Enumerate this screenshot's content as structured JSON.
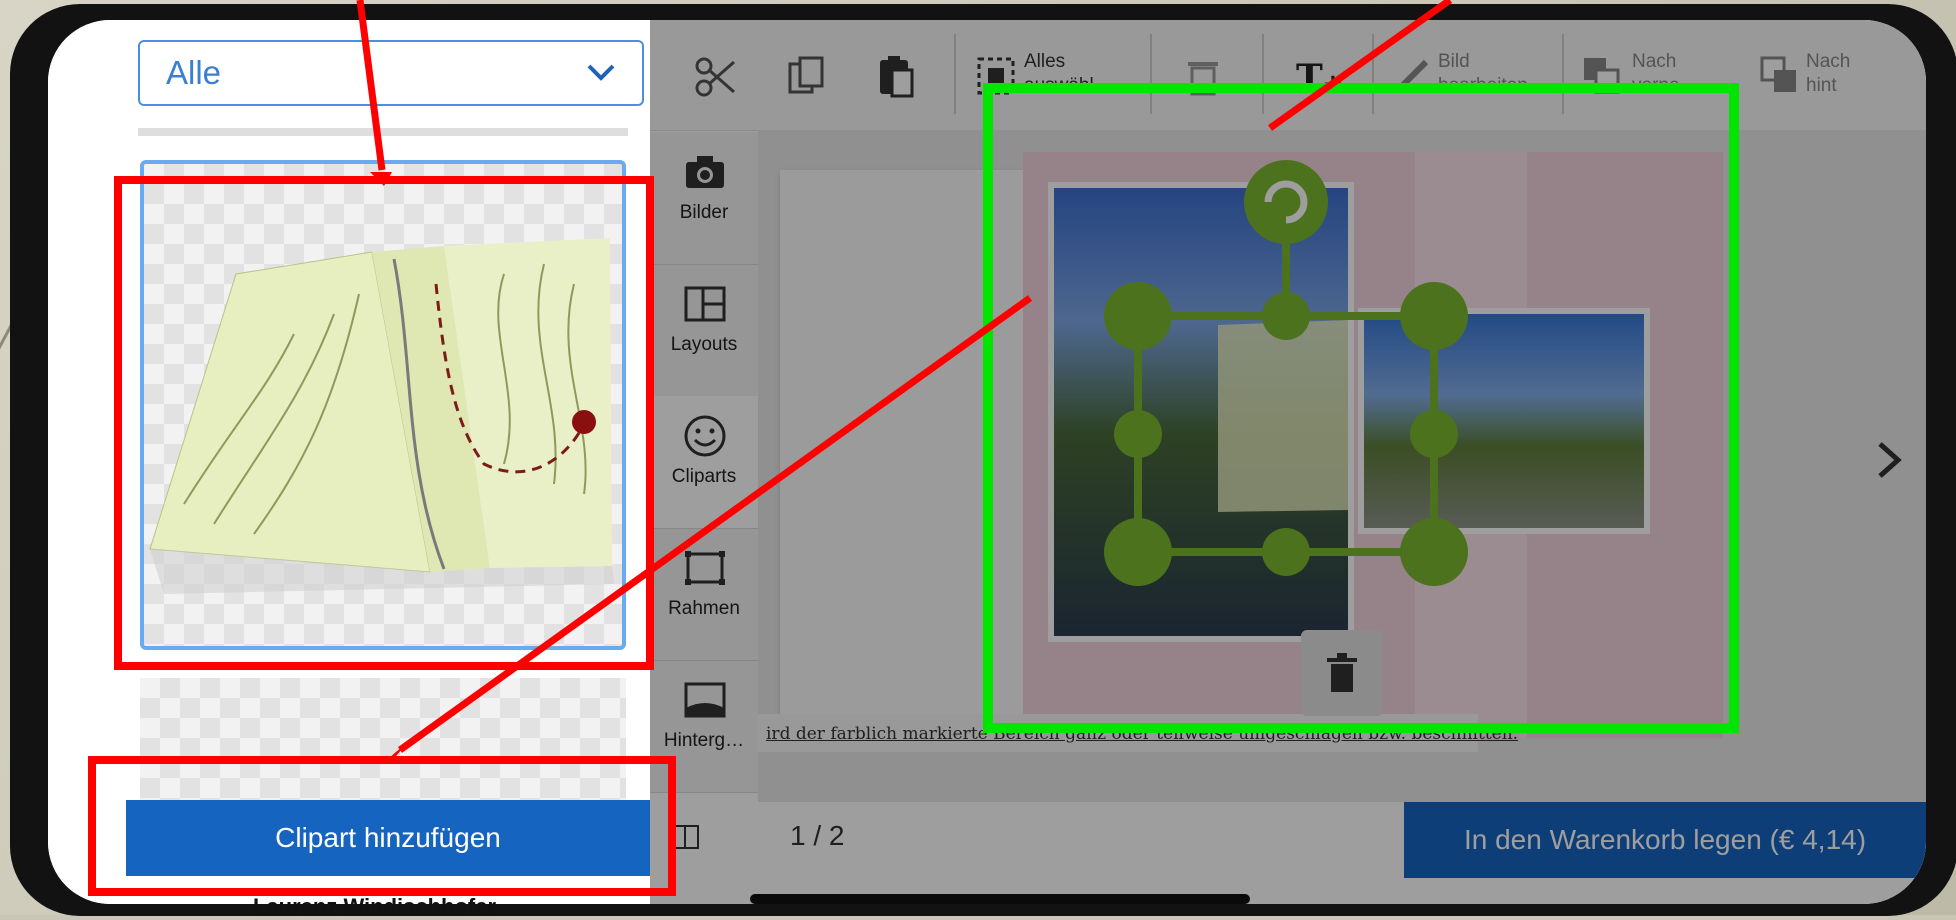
{
  "category_select": {
    "value": "Alle",
    "chevron_icon": "chevron-down-icon"
  },
  "side_tabs": [
    {
      "label": "Bilder",
      "icon": "camera-icon"
    },
    {
      "label": "Layouts",
      "icon": "layout-icon"
    },
    {
      "label": "Cliparts",
      "icon": "smiley-icon"
    },
    {
      "label": "Rahmen",
      "icon": "frame-icon"
    },
    {
      "label": "Hinterg…",
      "icon": "background-icon"
    }
  ],
  "toolbar": {
    "select_all": [
      "Alles",
      "auswähl"
    ],
    "edit_image": [
      "Bild",
      "bearbeiten"
    ],
    "bring_forward": [
      "Nach",
      "vorne"
    ],
    "send_backward": [
      "Nach",
      "hint"
    ],
    "icons": [
      "scissors-icon",
      "copy-icon",
      "paste-icon",
      "select-all-icon",
      "trash-icon",
      "add-text-icon",
      "brush-icon",
      "bring-forward-icon",
      "send-backward-icon"
    ]
  },
  "warning_text": "ird der farblich markierte Bereich ganz oder teilweise umgeschlagen bzw. beschnitten.",
  "add_clipart_label": "Clipart hinzufügen",
  "page_indicator": "1 / 2",
  "cart_button_label": "In den Warenkorb legen (€ 4,14)",
  "caption": "Laurenz Windischhofer",
  "annotation_colors": {
    "highlight_red": "#ff0000",
    "highlight_green": "#00e600",
    "selection_green": "#7cb82f",
    "button_blue": "#1565c0"
  }
}
